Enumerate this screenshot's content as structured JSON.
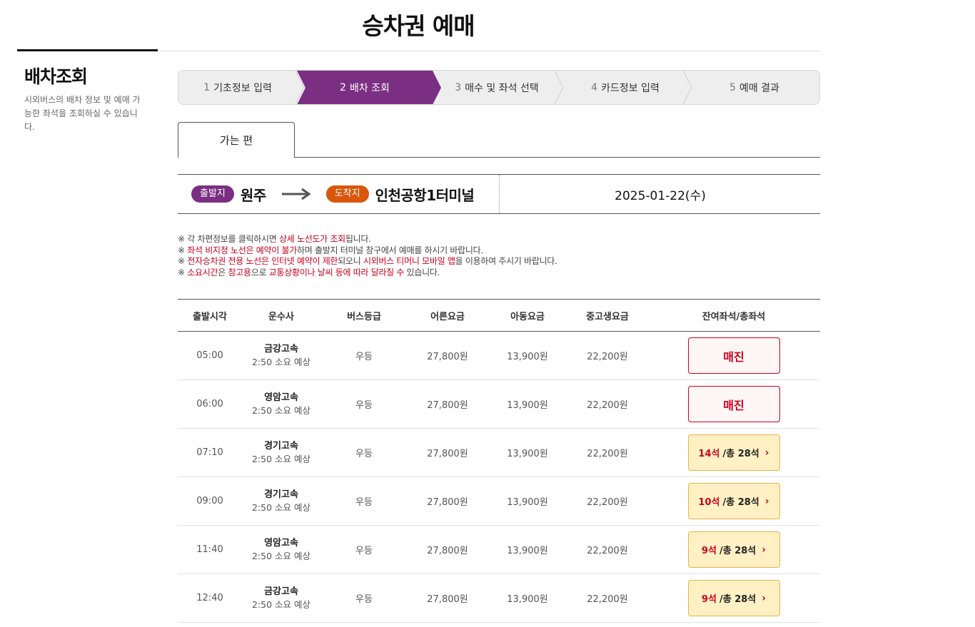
{
  "page": {
    "title": "승차권 예매"
  },
  "sidebar": {
    "title": "배차조회",
    "description": "시외버스의 배차 정보 및 예매 가능한 좌석을 조회하실 수 있습니다."
  },
  "steps": [
    {
      "num": "1",
      "label": "기초정보 입력",
      "active": false
    },
    {
      "num": "2",
      "label": "배차 조회",
      "active": true
    },
    {
      "num": "3",
      "label": "매수 및 좌석 선택",
      "active": false
    },
    {
      "num": "4",
      "label": "카드정보 입력",
      "active": false
    },
    {
      "num": "5",
      "label": "예매 결과",
      "active": false
    }
  ],
  "tabs": {
    "outbound": "가는 편"
  },
  "route": {
    "departure_tag": "출발지",
    "departure": "원주",
    "arrival_tag": "도착지",
    "arrival": "인천공항1터미널",
    "date": "2025-01-22(수)"
  },
  "notices": [
    [
      {
        "t": "※ 각 차편정보를 클릭하시면 "
      },
      {
        "t": "상세 노선도가 조회",
        "red": true
      },
      {
        "t": "됩니다."
      }
    ],
    [
      {
        "t": "※ "
      },
      {
        "t": "좌석 비지정 노선은 예약이 불가",
        "red": true
      },
      {
        "t": "하며 출발지 터미널 창구에서 예매를 하시기 바랍니다."
      }
    ],
    [
      {
        "t": "※ "
      },
      {
        "t": "전자승차권 전용 노선은 인터넷 예약이 제한",
        "red": true
      },
      {
        "t": "되오니 "
      },
      {
        "t": "시외버스 티머니 모바일 앱",
        "red": true
      },
      {
        "t": "을 이용하여 주시기 바랍니다."
      }
    ],
    [
      {
        "t": "※ "
      },
      {
        "t": "소요시간",
        "red": true
      },
      {
        "t": "은 "
      },
      {
        "t": "참고용",
        "red": true
      },
      {
        "t": "으로 "
      },
      {
        "t": "교통상황이나 날씨 등에 따라 달라질 수",
        "red": true
      },
      {
        "t": " 있습니다."
      }
    ]
  ],
  "table": {
    "headers": [
      "출발시각",
      "운수사",
      "버스등급",
      "어른요금",
      "아동요금",
      "중고생요금",
      "잔여좌석/총좌석"
    ],
    "rows": [
      {
        "time": "05:00",
        "operator": "금강고속",
        "duration": "2:50 소요 예상",
        "grade": "우등",
        "adult": "27,800원",
        "child": "13,900원",
        "teen": "22,200원",
        "status": "soldout",
        "soldout_label": "매진"
      },
      {
        "time": "06:00",
        "operator": "영암고속",
        "duration": "2:50 소요 예상",
        "grade": "우등",
        "adult": "27,800원",
        "child": "13,900원",
        "teen": "22,200원",
        "status": "soldout",
        "soldout_label": "매진"
      },
      {
        "time": "07:10",
        "operator": "경기고속",
        "duration": "2:50 소요 예상",
        "grade": "우등",
        "adult": "27,800원",
        "child": "13,900원",
        "teen": "22,200원",
        "status": "avail",
        "remain": "14석",
        "total": "/총 28석"
      },
      {
        "time": "09:00",
        "operator": "경기고속",
        "duration": "2:50 소요 예상",
        "grade": "우등",
        "adult": "27,800원",
        "child": "13,900원",
        "teen": "22,200원",
        "status": "avail",
        "remain": "10석",
        "total": "/총 28석"
      },
      {
        "time": "11:40",
        "operator": "영암고속",
        "duration": "2:50 소요 예상",
        "grade": "우등",
        "adult": "27,800원",
        "child": "13,900원",
        "teen": "22,200원",
        "status": "avail",
        "remain": "9석",
        "total": "/총 28석"
      },
      {
        "time": "12:40",
        "operator": "금강고속",
        "duration": "2:50 소요 예상",
        "grade": "우등",
        "adult": "27,800원",
        "child": "13,900원",
        "teen": "22,200원",
        "status": "avail",
        "remain": "9석",
        "total": "/총 28석"
      }
    ]
  },
  "colors": {
    "accent_purple": "#7b2f83",
    "arrival_orange": "#d9560b",
    "red": "#c8001e",
    "seat_yellow": "#fff1c4"
  }
}
